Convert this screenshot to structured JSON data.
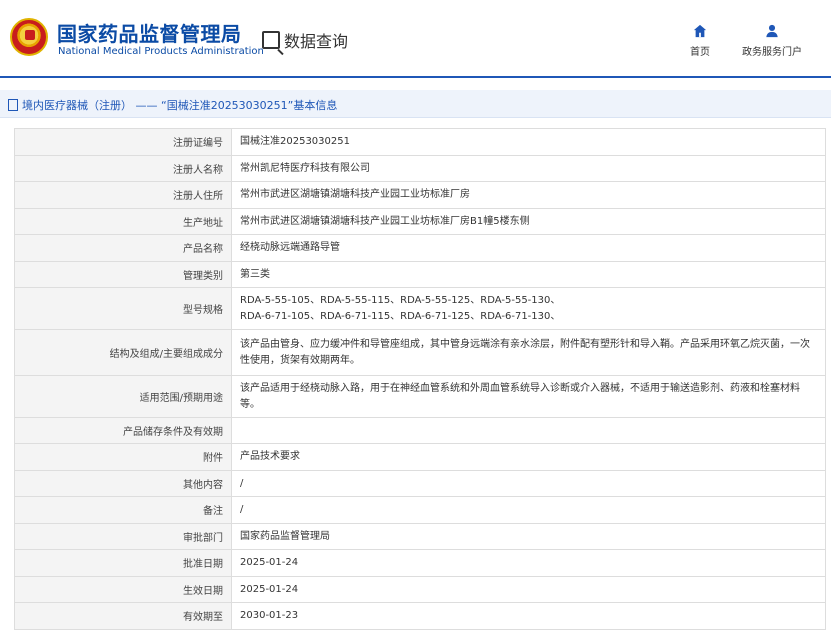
{
  "header": {
    "brand_cn": "国家药品监督管理局",
    "brand_en": "National Medical Products Administration",
    "query_title": "数据查询",
    "nav": [
      {
        "label": "首页",
        "icon": "home-icon"
      },
      {
        "label": "政务服务门户",
        "icon": "user-icon"
      }
    ]
  },
  "breadcrumb": "境内医疗器械（注册） —— “国械注准20253030251”基本信息",
  "table": {
    "rows": [
      {
        "label": "注册证编号",
        "value": "国械注准20253030251"
      },
      {
        "label": "注册人名称",
        "value": "常州凯尼特医疗科技有限公司"
      },
      {
        "label": "注册人住所",
        "value": "常州市武进区湖塘镇湖塘科技产业园工业坊标准厂房"
      },
      {
        "label": "生产地址",
        "value": "常州市武进区湖塘镇湖塘科技产业园工业坊标准厂房B1幢5楼东侧"
      },
      {
        "label": "产品名称",
        "value": "经桡动脉远端通路导管"
      },
      {
        "label": "管理类别",
        "value": "第三类"
      },
      {
        "label": "型号规格",
        "value": "RDA-5-55-105、RDA-5-55-115、RDA-5-55-125、RDA-5-55-130、\nRDA-6-71-105、RDA-6-71-115、RDA-6-71-125、RDA-6-71-130、"
      },
      {
        "label": "结构及组成/主要组成成分",
        "value": "该产品由管身、应力缓冲件和导管座组成，其中管身远端涂有亲水涂层，附件配有塑形针和导入鞘。产品采用环氧乙烷灭菌，一次性使用，货架有效期两年。"
      },
      {
        "label": "适用范围/预期用途",
        "value": "该产品适用于经桡动脉入路，用于在神经血管系统和外周血管系统导入诊断或介入器械，不适用于输送造影剂、药液和栓塞材料等。"
      },
      {
        "label": "产品储存条件及有效期",
        "value": ""
      },
      {
        "label": "附件",
        "value": "产品技术要求"
      },
      {
        "label": "其他内容",
        "value": "/"
      },
      {
        "label": "备注",
        "value": "/"
      },
      {
        "label": "审批部门",
        "value": "国家药品监督管理局"
      },
      {
        "label": "批准日期",
        "value": "2025-01-24"
      },
      {
        "label": "生效日期",
        "value": "2025-01-24"
      },
      {
        "label": "有效期至",
        "value": "2030-01-23"
      }
    ]
  }
}
